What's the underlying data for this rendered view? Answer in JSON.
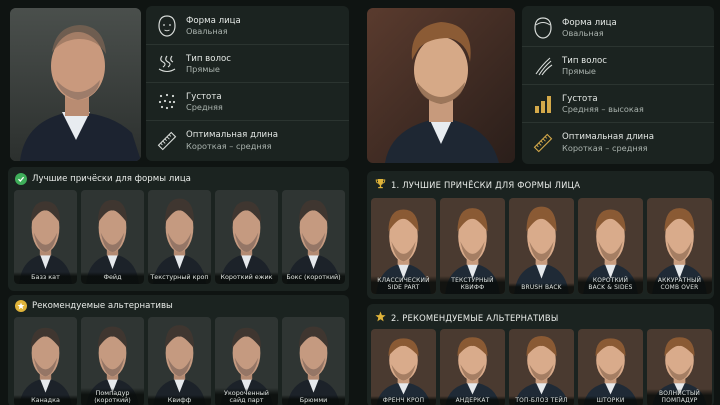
{
  "left": {
    "attributes": [
      {
        "label": "Форма лица",
        "value": "Овальная",
        "icon": "face-outline-icon"
      },
      {
        "label": "Тип волос",
        "value": "Прямые",
        "icon": "hair-wave-icon"
      },
      {
        "label": "Густота",
        "value": "Средняя",
        "icon": "density-dots-icon"
      },
      {
        "label": "Оптимальная длина",
        "value": "Короткая – средняя",
        "icon": "ruler-icon"
      }
    ],
    "best": {
      "title": "Лучшие причёски для формы лица",
      "items": [
        "Базз кат",
        "Фейд",
        "Текстурный кроп",
        "Короткий ежик",
        "Бокс (короткий)"
      ]
    },
    "alternatives": {
      "title": "Рекомендуемые альтернативы",
      "items": [
        "Канадка",
        "Помпадур (короткий)",
        "Квифф",
        "Укороченный сайд парт",
        "Брюмми"
      ]
    }
  },
  "right": {
    "attributes": [
      {
        "label": "Форма лица",
        "value": "Овальная",
        "icon": "face-outline-icon"
      },
      {
        "label": "Тип волос",
        "value": "Прямые",
        "icon": "hair-strands-icon"
      },
      {
        "label": "Густота",
        "value": "Средняя – высокая",
        "icon": "density-bars-icon"
      },
      {
        "label": "Оптимальная длина",
        "value": "Короткая – средняя",
        "icon": "ruler-icon"
      }
    ],
    "best": {
      "title": "1. ЛУЧШИЕ ПРИЧЁСКИ ДЛЯ ФОРМЫ ЛИЦА",
      "items": [
        "КЛАССИЧЕСКИЙ\nSIDE PART",
        "ТЕКСТУРНЫЙ\nКВИФФ",
        "BRUSH BACK",
        "КОРОТКИЙ\nBACK & SIDES",
        "АККУРАТНЫЙ\nCOMB OVER"
      ]
    },
    "alternatives": {
      "title": "2. РЕКОМЕНДУЕМЫЕ АЛЬТЕРНАТИВЫ",
      "items": [
        "ФРЕНЧ КРОП",
        "АНДЕРКАТ",
        "ТОП-БЛОЗ ТЕЙЛ",
        "ШТОРКИ",
        "ВОЛНИСТЫЙ\nПОМПАДУР"
      ]
    }
  },
  "colors": {
    "accent_green": "#3fae5a",
    "accent_gold": "#e0b43a",
    "panel": "#1b2320",
    "background": "#0f1412"
  }
}
